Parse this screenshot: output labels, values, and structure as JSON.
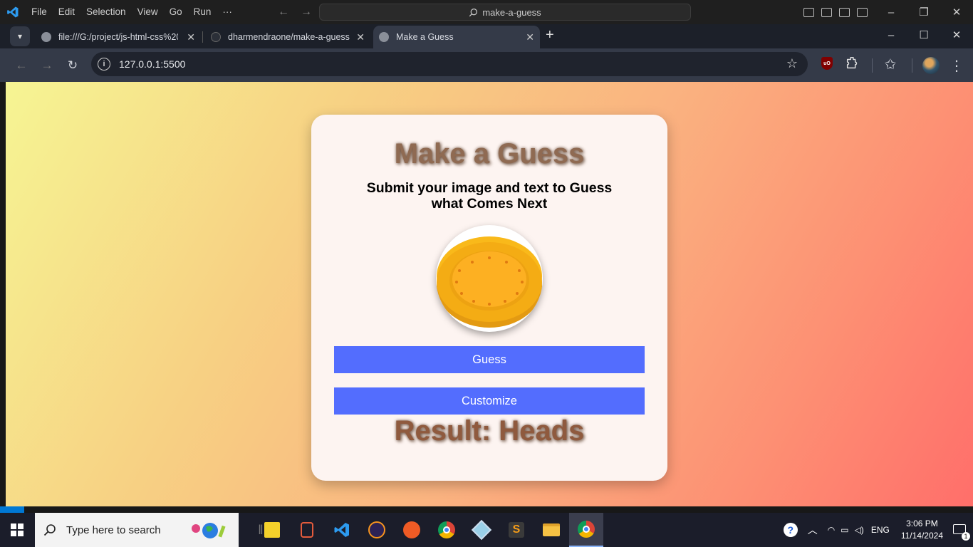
{
  "vscode": {
    "menu": [
      "File",
      "Edit",
      "Selection",
      "View",
      "Go",
      "Run",
      "···"
    ],
    "search": "make-a-guess"
  },
  "browser": {
    "tabs": [
      {
        "title": "file:///G:/project/js-html-css%20"
      },
      {
        "title": "dharmendraone/make-a-guess"
      },
      {
        "title": "Make a Guess"
      }
    ],
    "url": "127.0.0.1:5500"
  },
  "page": {
    "title": "Make a Guess",
    "subtitle": "Submit your image and text to Guess what Comes Next",
    "guess_label": "Guess",
    "customize_label": "Customize",
    "result": "Result: Heads",
    "accent": "#536dfe"
  },
  "taskbar": {
    "search_placeholder": "Type here to search",
    "language": "ENG",
    "time": "3:06 PM",
    "date": "11/14/2024",
    "notifications": "1"
  }
}
